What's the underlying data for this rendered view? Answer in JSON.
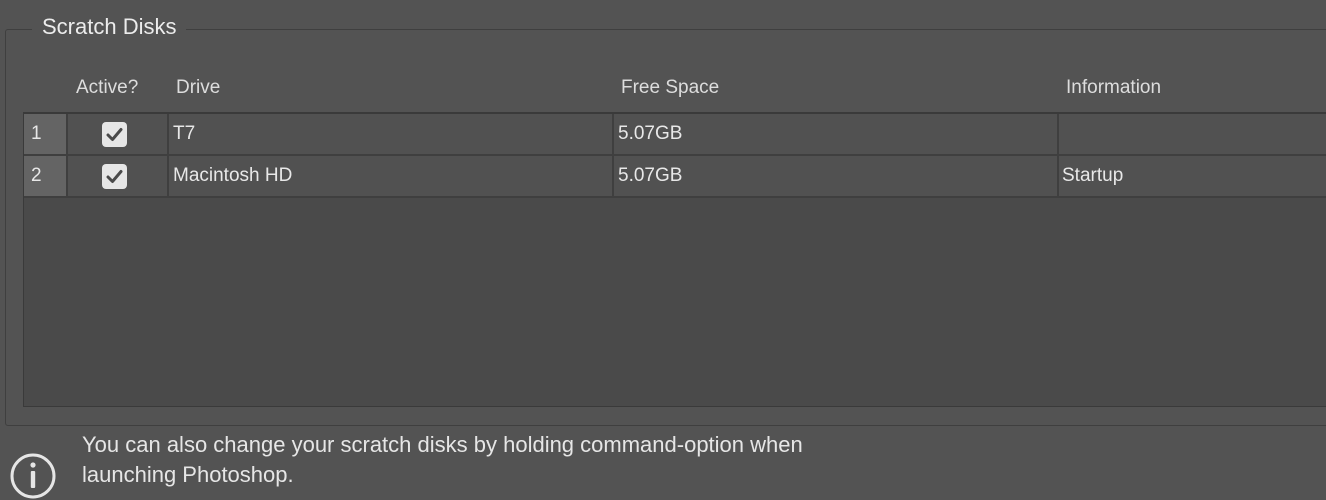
{
  "group": {
    "title": "Scratch Disks"
  },
  "columns": {
    "active": "Active?",
    "drive": "Drive",
    "free_space": "Free Space",
    "information": "Information"
  },
  "rows": [
    {
      "num": "1",
      "active": true,
      "drive": "T7",
      "free_space": "5.07GB",
      "information": ""
    },
    {
      "num": "2",
      "active": true,
      "drive": "Macintosh HD",
      "free_space": "5.07GB",
      "information": "Startup"
    }
  ],
  "footer": {
    "line1": "You can also change your scratch disks by holding command-option when",
    "line2": "launching Photoshop.",
    "icon": "info-icon"
  }
}
